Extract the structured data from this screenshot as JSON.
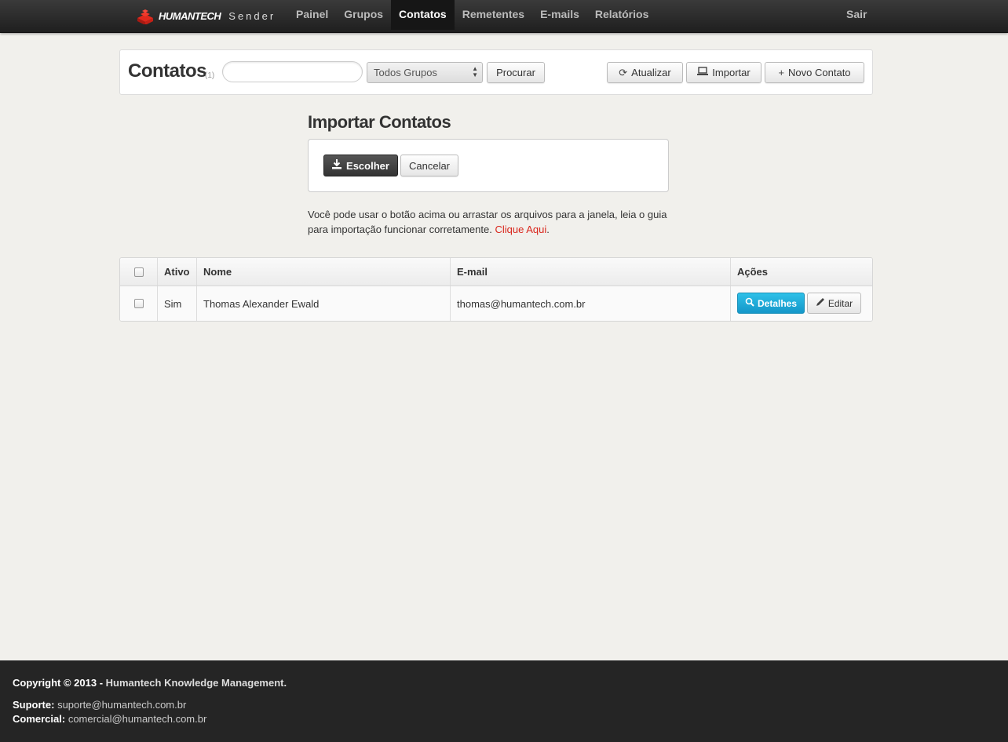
{
  "brand": {
    "name": "HUMANTECH",
    "sub": "Sender"
  },
  "nav": {
    "items": [
      {
        "label": "Painel"
      },
      {
        "label": "Grupos"
      },
      {
        "label": "Contatos",
        "active": true
      },
      {
        "label": "Remetentes"
      },
      {
        "label": "E-mails"
      },
      {
        "label": "Relatórios"
      }
    ],
    "logout": "Sair"
  },
  "toolbar": {
    "title": "Contatos",
    "count": "(1)",
    "search_value": "",
    "group_select": "Todos Grupos",
    "search_button": "Procurar",
    "refresh_button": "Atualizar",
    "import_button": "Importar",
    "new_button": "Novo Contato"
  },
  "import": {
    "title": "Importar Contatos",
    "choose_button": "Escolher",
    "cancel_button": "Cancelar",
    "help_text": "Você pode usar o botão acima ou arrastar os arquivos para a janela, leia o guia para importação funcionar corretamente.",
    "help_link": "Clique Aqui",
    "help_suffix": "."
  },
  "table": {
    "headers": {
      "active": "Ativo",
      "name": "Nome",
      "email": "E-mail",
      "actions": "Ações"
    },
    "rows": [
      {
        "active": "Sim",
        "name": "Thomas Alexander Ewald",
        "email": "thomas@humantech.com.br",
        "details": "Detalhes",
        "edit": "Editar"
      }
    ]
  },
  "footer": {
    "copyright_prefix": "Copyright © 2013 - ",
    "company": "Humantech Knowledge Management.",
    "support_label": "Suporte:",
    "support_email": "suporte@humantech.com.br",
    "commercial_label": "Comercial:",
    "commercial_email": "comercial@humantech.com.br"
  },
  "colors": {
    "accent": "#1597c9",
    "link": "#d9261c",
    "nav_bg": "#2b2b2b",
    "logo": "#d9261c"
  }
}
